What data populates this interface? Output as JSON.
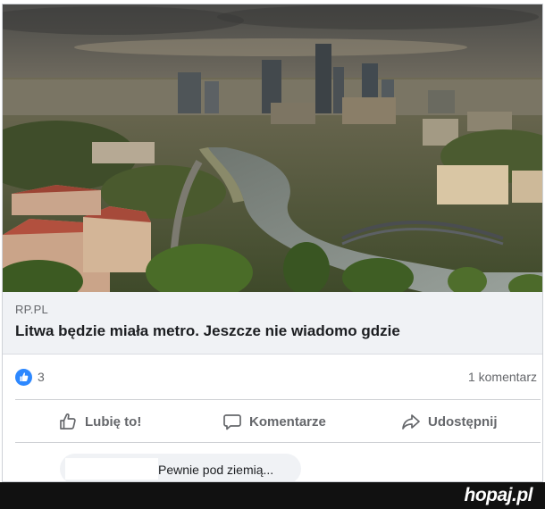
{
  "post": {
    "link_domain": "RP.PL",
    "link_title": "Litwa będzie miała metro. Jeszcze nie wiadomo gdzie",
    "like_count": "3",
    "comment_count": "1 komentarz"
  },
  "actions": {
    "like_label": "Lubię to!",
    "comment_label": "Komentarze",
    "share_label": "Udostępnij"
  },
  "comment_preview": {
    "text": "Pewnie pod ziemią..."
  },
  "watermark": {
    "text": "hopaj.pl"
  },
  "colors": {
    "accent": "#2d88ff",
    "muted_text": "#65676b",
    "link_background": "#f0f2f5"
  },
  "icons": [
    "thumbs-up-icon",
    "speech-bubble-icon",
    "share-arrow-icon"
  ]
}
